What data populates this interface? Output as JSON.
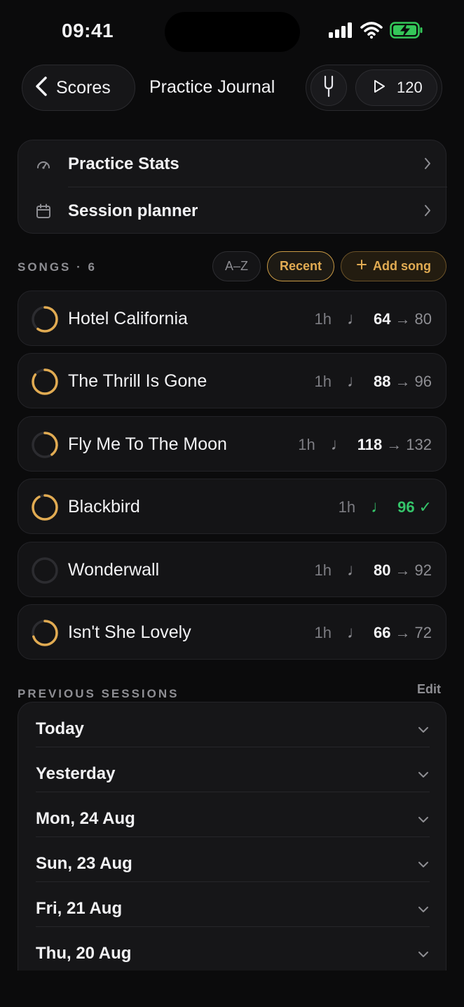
{
  "status_bar": {
    "time": "09:41"
  },
  "header": {
    "back_label": "Scores",
    "title": "Practice Journal",
    "tempo_value": "120"
  },
  "quick_links": [
    {
      "label": "Practice Stats",
      "icon": "gauge-icon"
    },
    {
      "label": "Session planner",
      "icon": "calendar-icon"
    }
  ],
  "songs_section": {
    "label": "SONGS · 6",
    "sort_az": "A–Z",
    "sort_recent": "Recent",
    "add_song": "Add song"
  },
  "songs": [
    {
      "title": "Hotel California",
      "time": "1h",
      "tempo": "64",
      "arrow": "→",
      "target": "80",
      "progress": 0.6,
      "status": "in-progress"
    },
    {
      "title": "The Thrill Is Gone",
      "time": "1h",
      "tempo": "88",
      "arrow": "→",
      "target": "96",
      "progress": 0.85,
      "status": "in-progress"
    },
    {
      "title": "Fly Me To The Moon",
      "time": "1h",
      "tempo": "118",
      "arrow": "→",
      "target": "132",
      "progress": 0.4,
      "status": "in-progress"
    },
    {
      "title": "Blackbird",
      "time": "1h",
      "tempo": "96",
      "check": "✓",
      "progress": 0.92,
      "status": "done"
    },
    {
      "title": "Wonderwall",
      "time": "1h",
      "tempo": "80",
      "arrow": "→",
      "target": "92",
      "progress": 0.0,
      "status": "not-started"
    },
    {
      "title": "Isn't She Lovely",
      "time": "1h",
      "tempo": "66",
      "arrow": "→",
      "target": "72",
      "progress": 0.7,
      "status": "in-progress"
    }
  ],
  "sessions_section": {
    "label": "PREVIOUS SESSIONS",
    "edit": "Edit",
    "items": [
      "Today",
      "Yesterday",
      "Mon, 24 Aug",
      "Sun, 23 Aug",
      "Fri, 21 Aug",
      "Thu, 20 Aug"
    ]
  },
  "colors": {
    "accent": "#e1ab52",
    "success": "#35c46a",
    "background": "#0b0b0c",
    "card": "#141416"
  }
}
